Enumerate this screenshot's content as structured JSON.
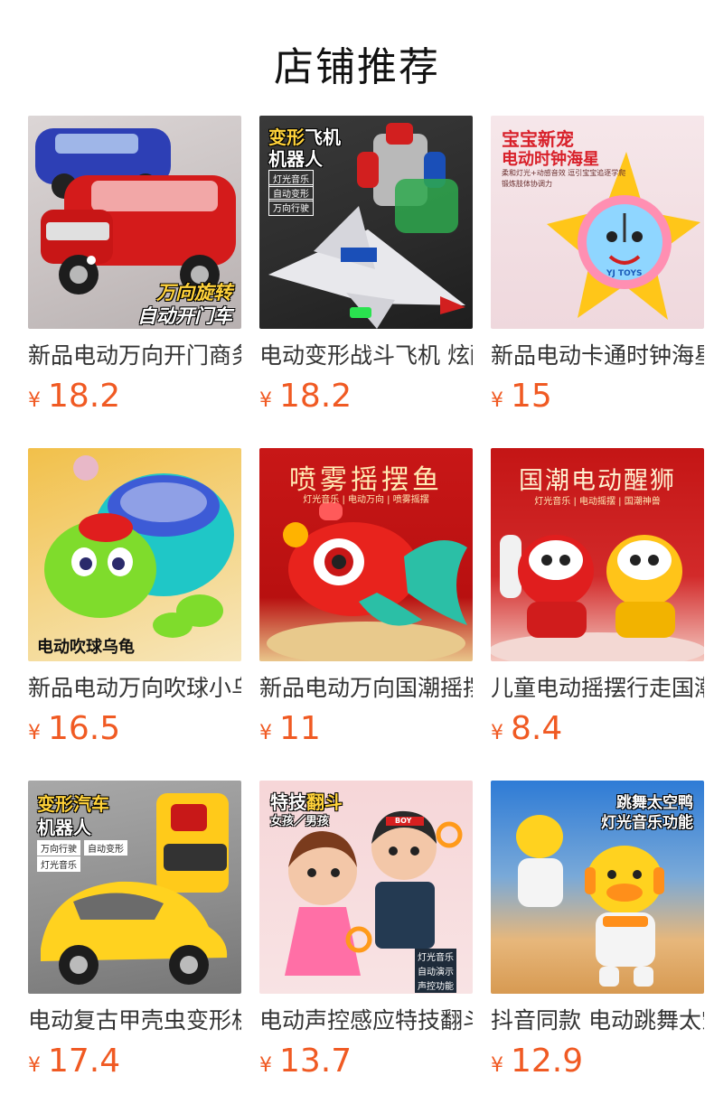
{
  "header": {
    "title": "店铺推荐"
  },
  "products": [
    {
      "name": "新品电动万向开门商务车",
      "currency": "¥",
      "price": "18.2",
      "overlay": {
        "line1": "万向旋转",
        "line2": "自动开门车"
      }
    },
    {
      "name": "电动变形战斗飞机 炫酷",
      "currency": "¥",
      "price": "18.2",
      "overlay": {
        "headline1": "变形",
        "headline1b": "飞机",
        "headline2": "机器人",
        "tags": [
          "灯光音乐",
          "自动变形",
          "万向行驶"
        ]
      }
    },
    {
      "name": "新品电动卡通时钟海星",
      "currency": "¥",
      "price": "15",
      "overlay": {
        "line1": "宝宝新宠",
        "line2": "电动时钟海星",
        "sub1": "柔和灯光+动感音效 逗引宝宝追逐学爬",
        "sub2": "锻炼肢体协调力",
        "logo": "YJ TOYS"
      }
    },
    {
      "name": "新品电动万向吹球小乌龟",
      "currency": "¥",
      "price": "16.5",
      "overlay": {
        "line1": "电动吹球乌龟"
      }
    },
    {
      "name": "新品电动万向国潮摇摆鱼",
      "currency": "¥",
      "price": "11",
      "overlay": {
        "line1": "喷雾摇摆鱼",
        "line2": "灯光音乐 | 电动万向 | 喷雾摇摆"
      }
    },
    {
      "name": "儿童电动摇摆行走国潮醒狮",
      "currency": "¥",
      "price": "8.4",
      "overlay": {
        "line1": "国潮电动醒狮",
        "line2": "灯光音乐 | 电动摇摆 | 国潮神兽"
      }
    },
    {
      "name": "电动复古甲壳虫变形机器人",
      "currency": "¥",
      "price": "17.4",
      "overlay": {
        "headline1": "变形汽车",
        "headline2": "机器人",
        "tags": [
          "万向行驶",
          "自动变形",
          "灯光音乐"
        ]
      }
    },
    {
      "name": "电动声控感应特技翻斗娃娃",
      "currency": "¥",
      "price": "13.7",
      "overlay": {
        "line1": "特技",
        "line1b": "翻斗",
        "line2": "女孩／男孩",
        "tags": [
          "灯光音乐",
          "自动演示",
          "声控功能"
        ],
        "badge": "BOY"
      }
    },
    {
      "name": "抖音同款 电动跳舞太空鸭",
      "currency": "¥",
      "price": "12.9",
      "overlay": {
        "line1": "跳舞太空鸭",
        "line2": "灯光音乐功能"
      }
    }
  ],
  "colors": {
    "price": "#f05a23",
    "title": "#111111",
    "name": "#333333"
  }
}
